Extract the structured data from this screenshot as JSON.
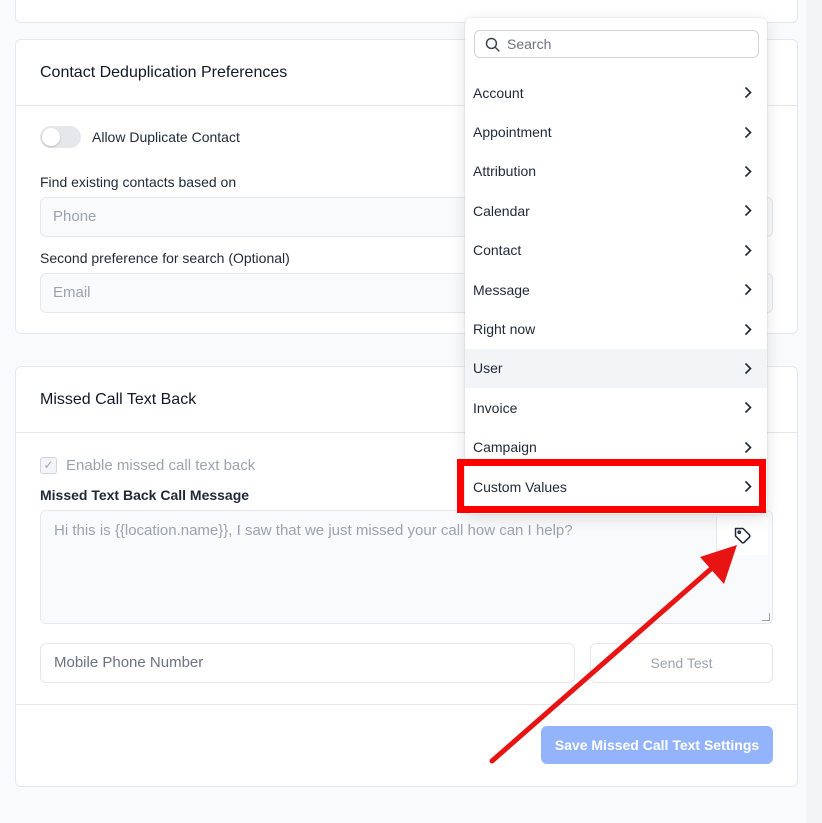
{
  "dedup": {
    "title": "Contact Deduplication Preferences",
    "toggle_label": "Allow Duplicate Contact",
    "find_label": "Find existing contacts based on",
    "find_value": "Phone",
    "second_label": "Second preference for search (Optional)",
    "second_value": "Email"
  },
  "mctb": {
    "title": "Missed Call Text Back",
    "enable_label": "Enable missed call text back",
    "message_label": "Missed Text Back Call Message",
    "message_placeholder": "Hi this is {{location.name}}, I saw that we just missed your call how can I help?",
    "phone_placeholder": "Mobile Phone Number",
    "send_test": "Send Test",
    "save": "Save Missed Call Text Settings"
  },
  "dropdown": {
    "search_placeholder": "Search",
    "items": [
      {
        "label": "Account"
      },
      {
        "label": "Appointment"
      },
      {
        "label": "Attribution"
      },
      {
        "label": "Calendar"
      },
      {
        "label": "Contact"
      },
      {
        "label": "Message"
      },
      {
        "label": "Right now"
      },
      {
        "label": "User"
      },
      {
        "label": "Invoice"
      },
      {
        "label": "Campaign"
      },
      {
        "label": "Custom Values"
      }
    ]
  },
  "icons": {
    "search": "search-icon",
    "chevron": "chevron-right-icon",
    "tag": "tag-icon",
    "check": "check-icon"
  },
  "colors": {
    "annotation": "#ff0000",
    "primary_disabled": "#93b4fb",
    "hover_row": "#f3f4f6"
  }
}
